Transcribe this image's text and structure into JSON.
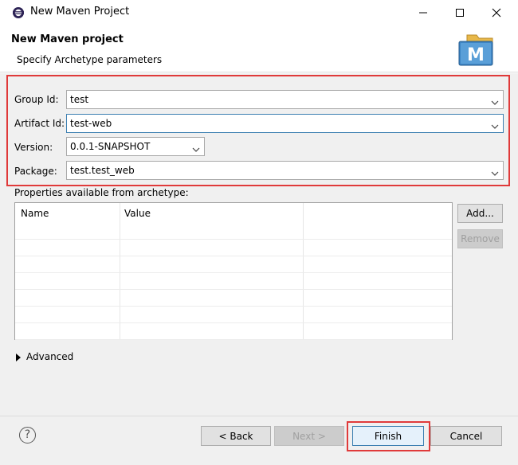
{
  "window": {
    "title": "New Maven Project"
  },
  "header": {
    "title": "New Maven project",
    "subtitle": "Specify Archetype parameters",
    "logo_letter": "M"
  },
  "form": {
    "group_id": {
      "label": "Group Id:",
      "value": "test"
    },
    "artifact_id": {
      "label": "Artifact Id:",
      "value": "test-web"
    },
    "version": {
      "label": "Version:",
      "value": "0.0.1-SNAPSHOT"
    },
    "package": {
      "label": "Package:",
      "value": "test.test_web"
    }
  },
  "properties": {
    "label": "Properties available from archetype:",
    "columns": [
      "Name",
      "Value"
    ],
    "rows": []
  },
  "side_buttons": {
    "add": "Add...",
    "remove": "Remove"
  },
  "advanced": {
    "label": "Advanced"
  },
  "footer": {
    "back": "< Back",
    "next": "Next >",
    "finish": "Finish",
    "cancel": "Cancel",
    "help": "?"
  },
  "colors": {
    "highlight": "#e03a3a",
    "dialog_bg": "#f0f0f0",
    "focus_border": "#3c7fb1"
  },
  "icons": [
    "eclipse-app-icon",
    "minimize-icon",
    "maximize-icon",
    "close-icon",
    "maven-logo-icon",
    "chevron-down-icon",
    "triangle-right-icon",
    "help-icon"
  ]
}
